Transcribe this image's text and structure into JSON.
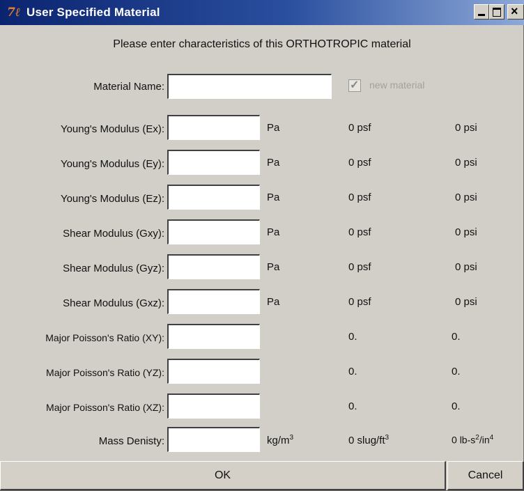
{
  "window": {
    "title": "User Specified Material",
    "icon": "tk-app-icon",
    "icon_glyph": "7ℓ"
  },
  "instructions": "Please enter characteristics of this ORTHOTROPIC material",
  "material_name": {
    "label": "Material Name:",
    "value": "",
    "checkbox_label": "new material",
    "checkbox_checked": true
  },
  "rows": [
    {
      "label": "Young's Modulus (Ex):",
      "value": "",
      "unit": "Pa",
      "psf": "0 psf",
      "psi": "0 psi"
    },
    {
      "label": "Young's Modulus (Ey):",
      "value": "",
      "unit": "Pa",
      "psf": "0 psf",
      "psi": "0 psi"
    },
    {
      "label": "Young's Modulus (Ez):",
      "value": "",
      "unit": "Pa",
      "psf": "0 psf",
      "psi": "0 psi"
    },
    {
      "label": "Shear Modulus (Gxy):",
      "value": "",
      "unit": "Pa",
      "psf": "0 psf",
      "psi": "0 psi"
    },
    {
      "label": "Shear Modulus (Gyz):",
      "value": "",
      "unit": "Pa",
      "psf": "0 psf",
      "psi": "0 psi"
    },
    {
      "label": "Shear Modulus (Gxz):",
      "value": "",
      "unit": "Pa",
      "psf": "0 psf",
      "psi": "0 psi"
    },
    {
      "label": "Major Poisson's Ratio (XY):",
      "value": "",
      "unit": "",
      "psf": "0.",
      "psi": "0."
    },
    {
      "label": "Major Poisson's Ratio (YZ):",
      "value": "",
      "unit": "",
      "psf": "0.",
      "psi": "0."
    },
    {
      "label": "Major Poisson's Ratio (XZ):",
      "value": "",
      "unit": "",
      "psf": "0.",
      "psi": "0."
    }
  ],
  "density": {
    "label": "Mass Denisty:",
    "value": "",
    "unit_base": "kg/m",
    "unit_exp": "3",
    "imperial_value": "0",
    "imperial_unit_base": "slug/ft",
    "imperial_unit_exp": "3",
    "inch_value": "0",
    "inch_unit_a": "lb-s",
    "inch_unit_a_exp": "2",
    "inch_unit_b": "/in",
    "inch_unit_b_exp": "4"
  },
  "buttons": {
    "ok": "OK",
    "cancel": "Cancel"
  }
}
